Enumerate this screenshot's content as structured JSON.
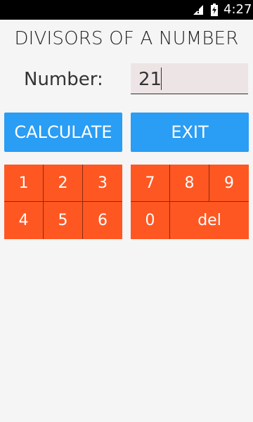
{
  "status_bar": {
    "time": "4:27"
  },
  "app": {
    "title": "DIVISORS OF A NUMBER"
  },
  "input": {
    "label": "Number:",
    "value": "21"
  },
  "buttons": {
    "calculate": "CALCULATE",
    "exit": "EXIT"
  },
  "keypad": {
    "left": [
      "1",
      "2",
      "3",
      "4",
      "5",
      "6"
    ],
    "right": [
      "7",
      "8",
      "9",
      "0",
      "del"
    ]
  },
  "colors": {
    "button_blue": "#2a9df4",
    "keypad_orange": "#ff5722",
    "field_bg": "#ede5e5"
  }
}
